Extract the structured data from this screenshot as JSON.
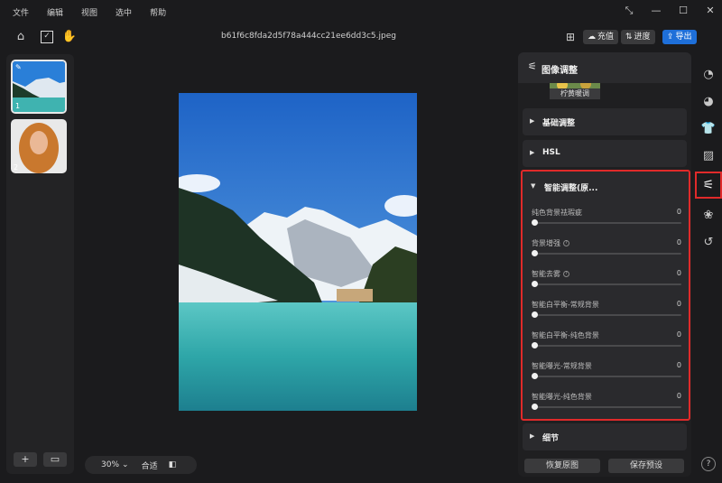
{
  "menu": [
    "文件",
    "编辑",
    "视图",
    "选中",
    "帮助"
  ],
  "toolbar": {
    "filename": "b61f6c8fda2d5f78a444cc21ee6dd3c5.jpeg",
    "recharge": "充值",
    "progress": "进度",
    "export": "导出"
  },
  "thumbnails": [
    {
      "num": "1"
    },
    {
      "num": "2"
    }
  ],
  "zoom": {
    "level": "30%",
    "fit": "合适"
  },
  "panel": {
    "title": "图像调整",
    "preset_label": "柠黄暖调",
    "sections": {
      "basic": "基础调整",
      "hsl": "HSL",
      "smart": "智能调整(原...",
      "detail": "细节"
    },
    "sliders": [
      {
        "name": "纯色背景祛瑕疵",
        "value": "0",
        "help": false
      },
      {
        "name": "背景增强",
        "value": "0",
        "help": true
      },
      {
        "name": "智能去雾",
        "value": "0",
        "help": true
      },
      {
        "name": "智能白平衡-常规背景",
        "value": "0",
        "help": false
      },
      {
        "name": "智能白平衡-纯色背景",
        "value": "0",
        "help": false
      },
      {
        "name": "智能曝光-常规背景",
        "value": "0",
        "help": false
      },
      {
        "name": "智能曝光-纯色背景",
        "value": "0",
        "help": false
      }
    ],
    "footer": {
      "reset": "恢复原图",
      "save_preset": "保存预设"
    }
  },
  "colors": {
    "accent_blue": "#1e6fd9",
    "highlight_red": "#e02a2a"
  },
  "icons": [
    "home-icon",
    "edit-image-icon",
    "hand-icon",
    "gift-icon",
    "compare-icon",
    "export-icon",
    "help-icon"
  ]
}
